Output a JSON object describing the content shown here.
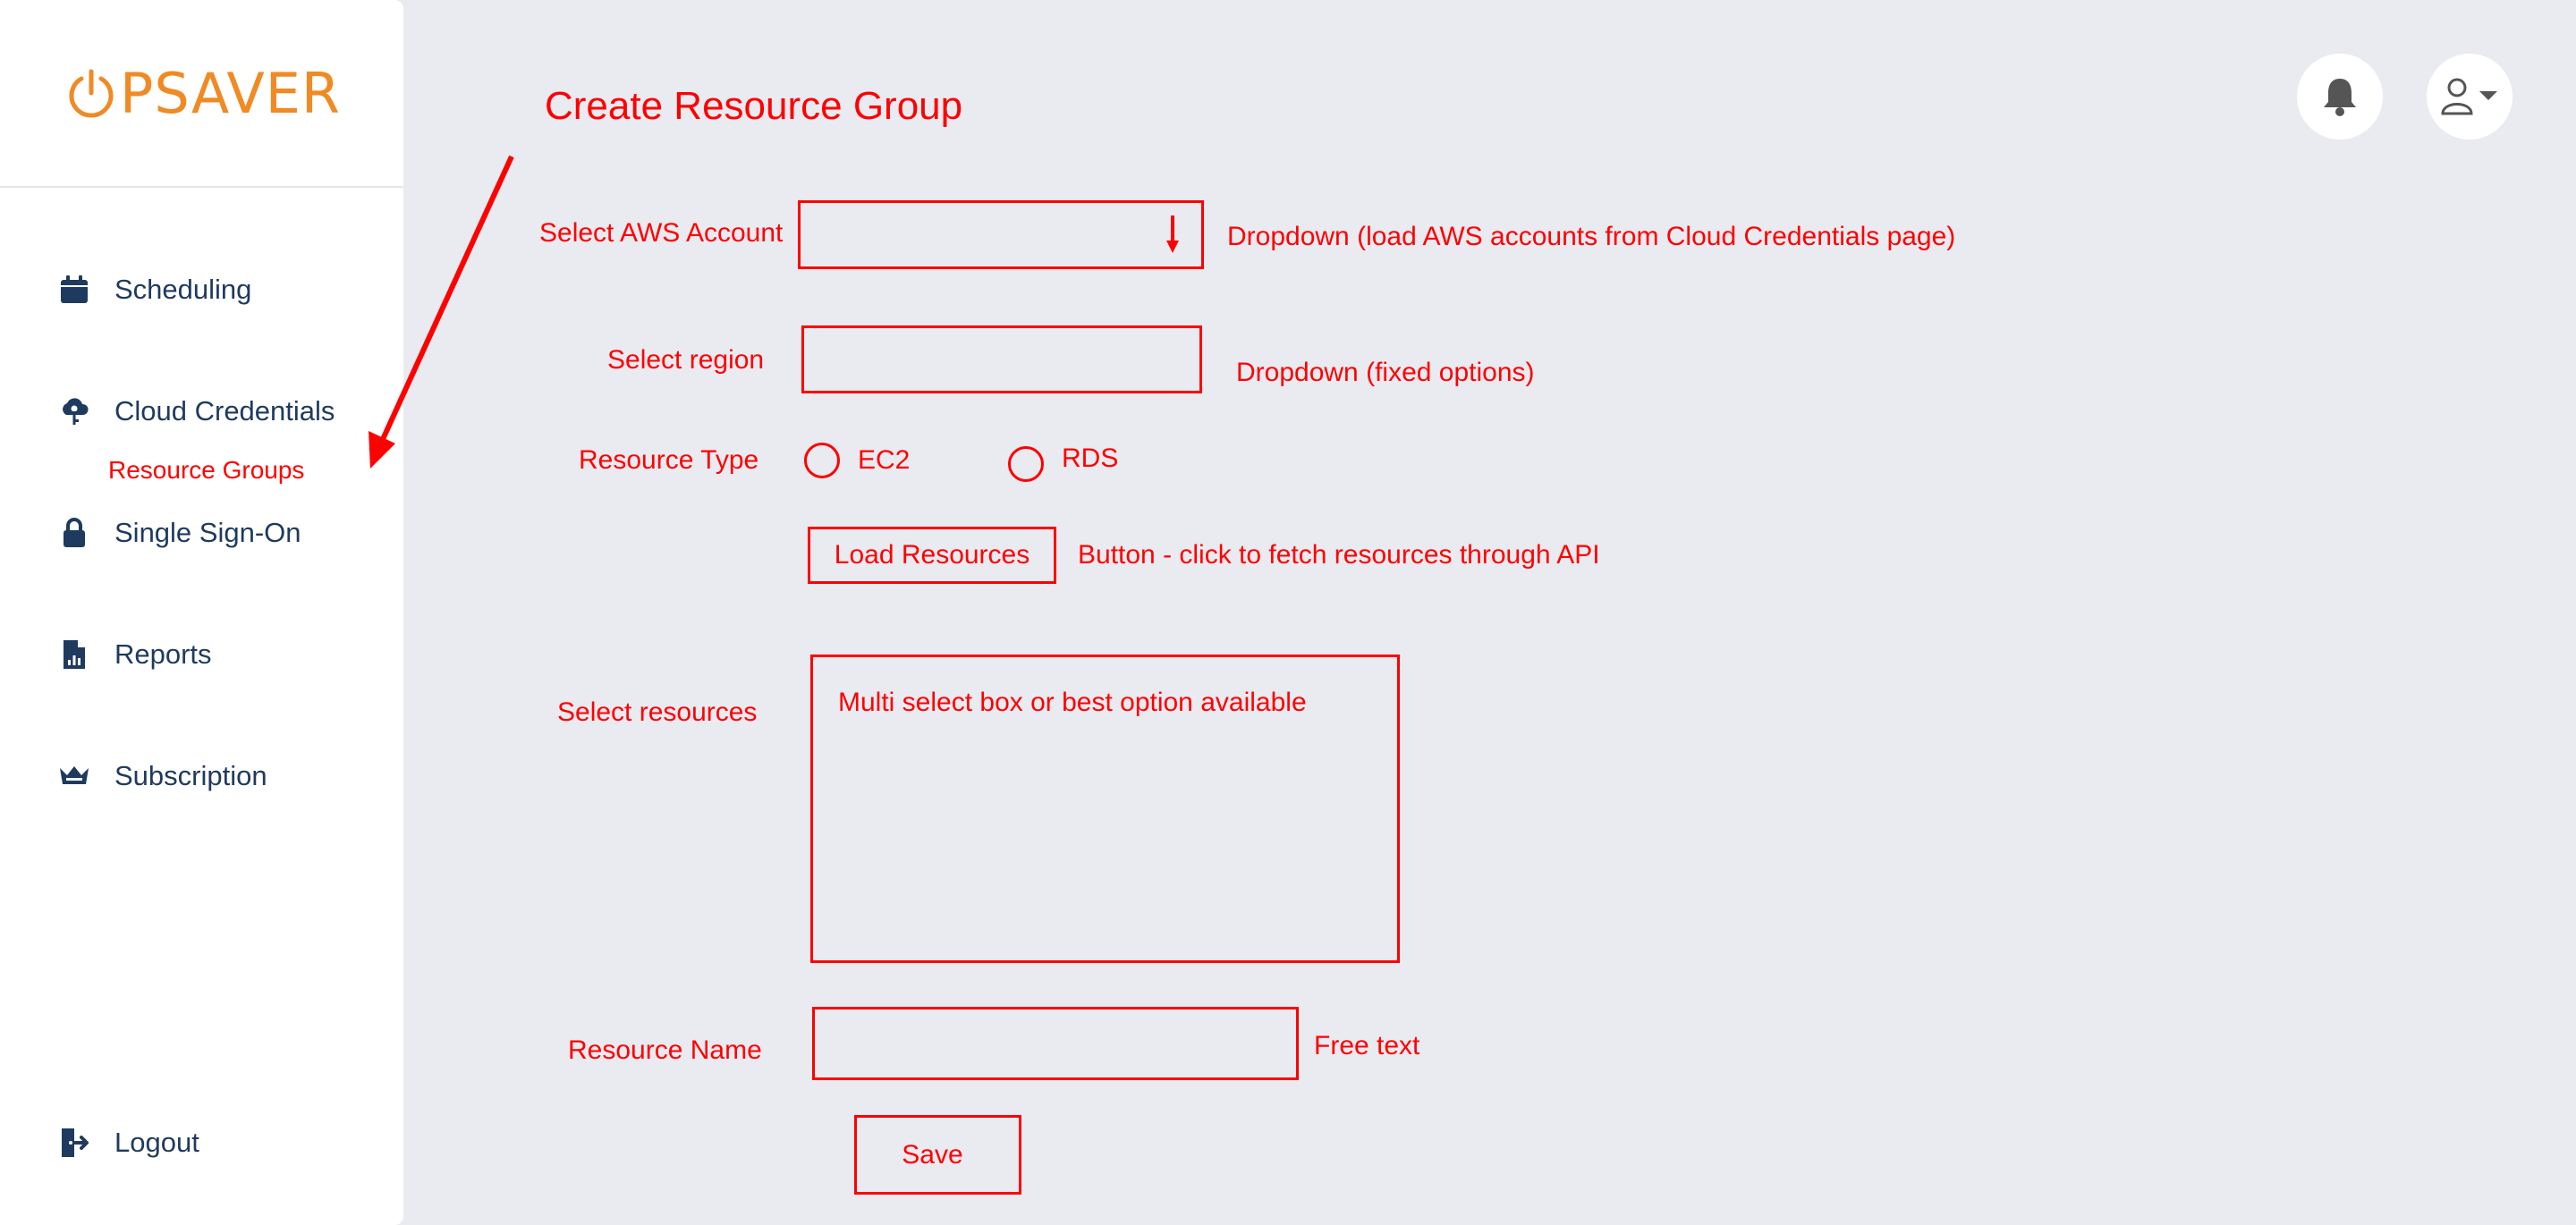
{
  "sidebar": {
    "logo": "PSAVER",
    "items": [
      {
        "label": "Scheduling",
        "icon": "calendar-icon"
      },
      {
        "label": "Cloud Credentials",
        "icon": "cloud-key-icon"
      },
      {
        "label": "Single Sign-On",
        "icon": "lock-icon"
      },
      {
        "label": "Reports",
        "icon": "report-icon"
      },
      {
        "label": "Subscription",
        "icon": "crown-icon"
      }
    ],
    "sub_item": "Resource Groups",
    "logout": {
      "label": "Logout",
      "icon": "logout-icon"
    }
  },
  "header": {
    "notification_icon": "bell-icon",
    "user_icon": "user-icon"
  },
  "form": {
    "title": "Create Resource Group",
    "aws_account_label": "Select AWS Account",
    "aws_account_note": "Dropdown (load AWS accounts from Cloud Credentials page)",
    "region_label": "Select region",
    "region_note": "Dropdown (fixed options)",
    "resource_type_label": "Resource Type",
    "resource_type_options": [
      "EC2",
      "RDS"
    ],
    "load_button": "Load Resources",
    "load_note": "Button - click to fetch resources through API",
    "resources_label": "Select resources",
    "resources_box_text": "Multi select box or best option available",
    "resource_name_label": "Resource Name",
    "resource_name_note": "Free text",
    "save_button": "Save"
  },
  "colors": {
    "accent": "#ff0000",
    "brand": "#f08a24",
    "nav_text": "#1f3a5f",
    "background": "#e9ebf1"
  }
}
